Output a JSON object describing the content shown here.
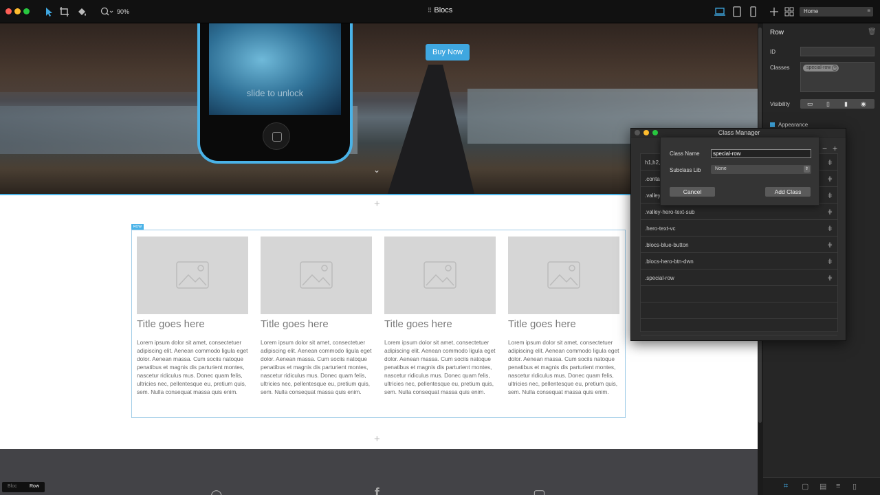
{
  "app": {
    "title": "Blocs",
    "zoom": "90%",
    "page_select": "Home"
  },
  "colors": {
    "accent": "#3fa7e0",
    "traffic_red": "#fe5f57",
    "traffic_yellow": "#febc2e",
    "traffic_green": "#28c840"
  },
  "toolbar": {
    "icons": [
      "select-arrow-icon",
      "crop-icon",
      "paint-bucket-icon",
      "zoom-icon",
      "laptop-icon",
      "tablet-icon",
      "phone-icon",
      "plus-icon",
      "grid-icon"
    ]
  },
  "hero": {
    "buy_button": "Buy Now",
    "phone_text": "slide to unlock"
  },
  "row": {
    "tag": "ROW",
    "cards": [
      {
        "title": "Title goes here",
        "text": "Lorem ipsum dolor sit amet, consectetuer adipiscing elit. Aenean commodo ligula eget dolor. Aenean massa. Cum sociis natoque penatibus et magnis dis parturient montes, nascetur ridiculus mus. Donec quam felis, ultricies nec, pellentesque eu, pretium quis, sem. Nulla consequat massa quis enim."
      },
      {
        "title": "Title goes here",
        "text": "Lorem ipsum dolor sit amet, consectetuer adipiscing elit. Aenean commodo ligula eget dolor. Aenean massa. Cum sociis natoque penatibus et magnis dis parturient montes, nascetur ridiculus mus. Donec quam felis, ultricies nec, pellentesque eu, pretium quis, sem. Nulla consequat massa quis enim."
      },
      {
        "title": "Title goes here",
        "text": "Lorem ipsum dolor sit amet, consectetuer adipiscing elit. Aenean commodo ligula eget dolor. Aenean massa. Cum sociis natoque penatibus et magnis dis parturient montes, nascetur ridiculus mus. Donec quam felis, ultricies nec, pellentesque eu, pretium quis, sem. Nulla consequat massa quis enim."
      },
      {
        "title": "Title goes here",
        "text": "Lorem ipsum dolor sit amet, consectetuer adipiscing elit. Aenean commodo ligula eget dolor. Aenean massa. Cum sociis natoque penatibus et magnis dis parturient montes, nascetur ridiculus mus. Donec quam felis, ultricies nec, pellentesque eu, pretium quis, sem. Nulla consequat massa quis enim."
      }
    ]
  },
  "panel": {
    "title": "Row",
    "id_label": "ID",
    "id_value": "",
    "classes_label": "Classes",
    "class_chip": "special-row",
    "visibility_label": "Visibility",
    "appearance_label": "Appearance"
  },
  "class_manager": {
    "title": "Class Manager",
    "classes": [
      "h1,h2,...",
      ".conta...",
      ".valley...",
      ".valley-hero-text-sub",
      ".hero-text-vc",
      ".blocs-blue-button",
      ".blocs-hero-btn-dwn",
      ".special-row"
    ],
    "sheet": {
      "class_name_label": "Class Name",
      "class_name_value": "special-row",
      "subclass_label": "Subclass Lib",
      "subclass_value": "None",
      "cancel": "Cancel",
      "add": "Add Class"
    }
  },
  "mode_tabs": {
    "bloc": "Bloc",
    "row": "Row"
  }
}
